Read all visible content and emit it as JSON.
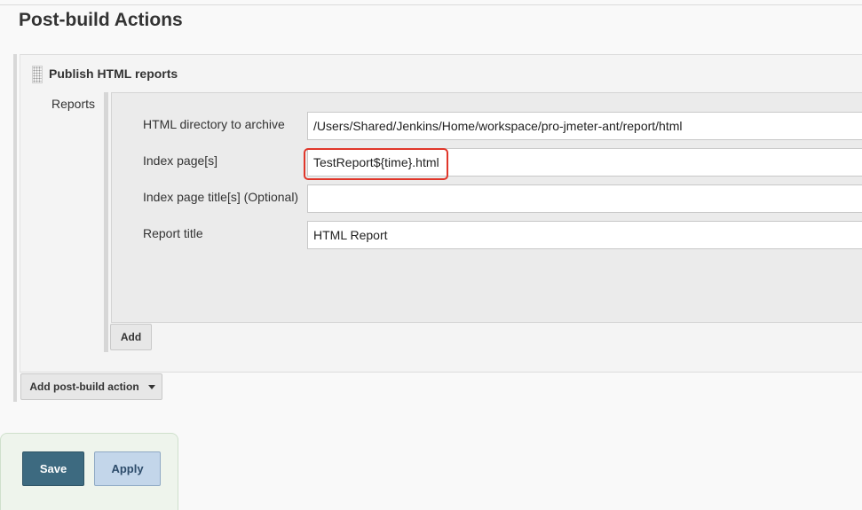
{
  "section": {
    "title": "Post-build Actions"
  },
  "publisher": {
    "title": "Publish HTML reports",
    "reports_label": "Reports",
    "fields": {
      "html_dir": {
        "label": "HTML directory to archive",
        "value": "/Users/Shared/Jenkins/Home/workspace/pro-jmeter-ant/report/html"
      },
      "index_pages": {
        "label": "Index page[s]",
        "value": "TestReport${time}.html"
      },
      "index_titles": {
        "label": "Index page title[s] (Optional)",
        "value": ""
      },
      "report_title": {
        "label": "Report title",
        "value": "HTML Report"
      }
    },
    "add_label": "Add"
  },
  "add_post_build_label": "Add post-build action",
  "actions": {
    "save_label": "Save",
    "apply_label": "Apply"
  },
  "colors": {
    "highlight": "#e0362a",
    "save": "#3d6a80",
    "apply": "#c3d6ea"
  },
  "icons": {
    "drag": "drag-handle-icon",
    "dropdown": "caret-down-icon"
  }
}
